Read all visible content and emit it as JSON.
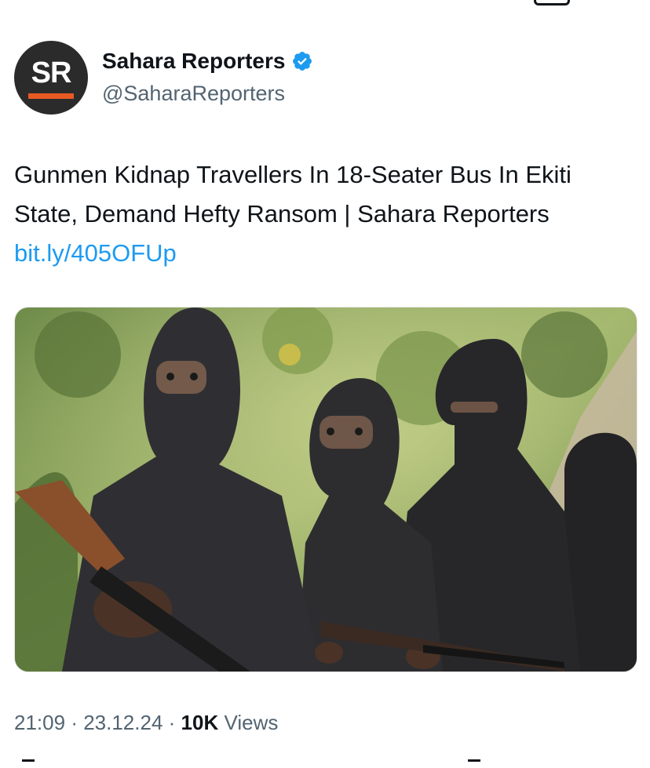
{
  "account": {
    "avatar_text": "SR",
    "display_name": "Sahara Reporters",
    "handle": "@SaharaReporters",
    "verified": true
  },
  "tweet": {
    "text": "Gunmen Kidnap Travellers In 18-Seater Bus In Ekiti State, Demand Hefty Ransom | Sahara Reporters ",
    "link": "bit.ly/405OFUp"
  },
  "media": {
    "description_icon": "photo-masked-gunmen"
  },
  "meta": {
    "time": "21:09",
    "date": "23.12.24",
    "views_count": "10K",
    "views_label": "Views"
  },
  "colors": {
    "link": "#1d9bf0",
    "secondary_text": "#536471",
    "verified": "#1d9bf0",
    "brand_orange": "#e85a24"
  }
}
